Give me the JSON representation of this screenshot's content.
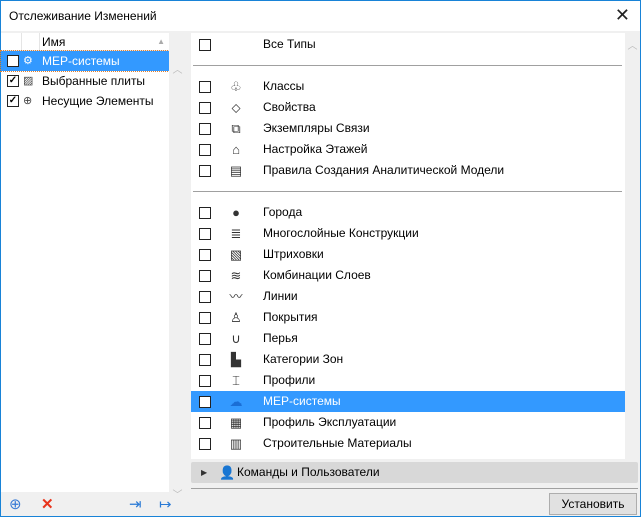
{
  "window": {
    "title": "Отслеживание Изменений",
    "close_icon": "close-icon"
  },
  "left": {
    "column_header": "Имя",
    "items": [
      {
        "label": "МЕР-системы",
        "checked": true,
        "selected": true,
        "icon": "mep-icon"
      },
      {
        "label": "Выбранные плиты",
        "checked": true,
        "selected": false,
        "icon": "slab-icon"
      },
      {
        "label": "Несущие Элементы",
        "checked": true,
        "selected": false,
        "icon": "structural-icon"
      }
    ]
  },
  "right": {
    "all_types": "Все Типы",
    "group1": [
      {
        "label": "Классы",
        "icon": "classes-icon"
      },
      {
        "label": "Свойства",
        "icon": "properties-icon"
      },
      {
        "label": "Экземпляры Связи",
        "icon": "hotlink-icon"
      },
      {
        "label": "Настройка Этажей",
        "icon": "stories-icon"
      },
      {
        "label": "Правила Создания Аналитической Модели",
        "icon": "analytical-icon"
      }
    ],
    "group2": [
      {
        "label": "Города",
        "icon": "globe-icon"
      },
      {
        "label": "Многослойные Конструкции",
        "icon": "composite-icon"
      },
      {
        "label": "Штриховки",
        "icon": "fill-icon"
      },
      {
        "label": "Комбинации Слоев",
        "icon": "layers-icon"
      },
      {
        "label": "Линии",
        "icon": "lines-icon"
      },
      {
        "label": "Покрытия",
        "icon": "surface-icon"
      },
      {
        "label": "Перья",
        "icon": "pen-icon"
      },
      {
        "label": "Категории Зон",
        "icon": "zone-icon"
      },
      {
        "label": "Профили",
        "icon": "profile-icon"
      },
      {
        "label": "МЕР-системы",
        "icon": "mep-icon",
        "checked": true,
        "selected": true
      },
      {
        "label": "Профиль Эксплуатации",
        "icon": "grid-icon"
      },
      {
        "label": "Строительные Материалы",
        "icon": "material-icon"
      }
    ]
  },
  "commands": {
    "label": "Команды и Пользователи"
  },
  "buttons": {
    "set": "Установить"
  }
}
